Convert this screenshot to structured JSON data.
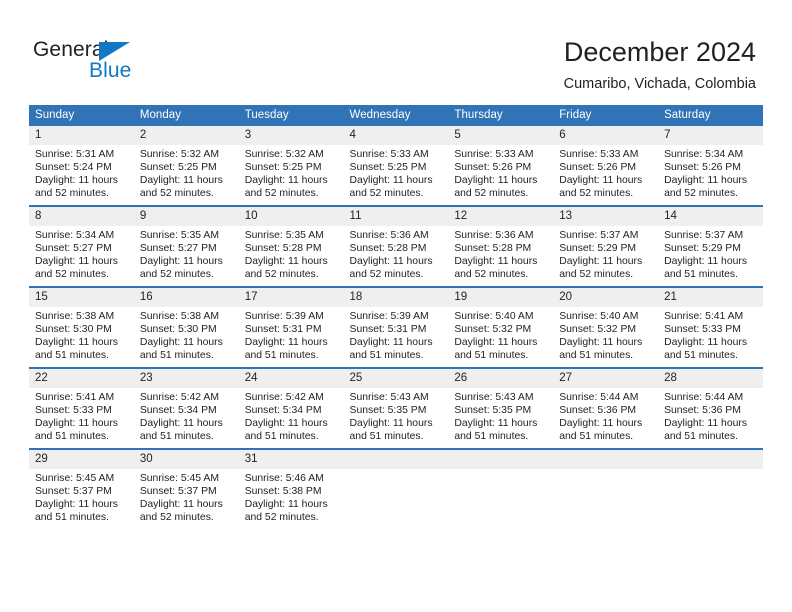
{
  "brand": {
    "name_part1": "General",
    "name_part2": "Blue"
  },
  "header": {
    "title": "December 2024",
    "subtitle": "Cumaribo, Vichada, Colombia"
  },
  "colors": {
    "header_blue": "#3073b7",
    "brand_blue": "#1277c4",
    "daynum_bg": "#efefef",
    "text": "#231f20"
  },
  "weekday_headers": [
    "Sunday",
    "Monday",
    "Tuesday",
    "Wednesday",
    "Thursday",
    "Friday",
    "Saturday"
  ],
  "weeks": [
    [
      {
        "day": "1",
        "sunrise": "Sunrise: 5:31 AM",
        "sunset": "Sunset: 5:24 PM",
        "daylight": "Daylight: 11 hours and 52 minutes."
      },
      {
        "day": "2",
        "sunrise": "Sunrise: 5:32 AM",
        "sunset": "Sunset: 5:25 PM",
        "daylight": "Daylight: 11 hours and 52 minutes."
      },
      {
        "day": "3",
        "sunrise": "Sunrise: 5:32 AM",
        "sunset": "Sunset: 5:25 PM",
        "daylight": "Daylight: 11 hours and 52 minutes."
      },
      {
        "day": "4",
        "sunrise": "Sunrise: 5:33 AM",
        "sunset": "Sunset: 5:25 PM",
        "daylight": "Daylight: 11 hours and 52 minutes."
      },
      {
        "day": "5",
        "sunrise": "Sunrise: 5:33 AM",
        "sunset": "Sunset: 5:26 PM",
        "daylight": "Daylight: 11 hours and 52 minutes."
      },
      {
        "day": "6",
        "sunrise": "Sunrise: 5:33 AM",
        "sunset": "Sunset: 5:26 PM",
        "daylight": "Daylight: 11 hours and 52 minutes."
      },
      {
        "day": "7",
        "sunrise": "Sunrise: 5:34 AM",
        "sunset": "Sunset: 5:26 PM",
        "daylight": "Daylight: 11 hours and 52 minutes."
      }
    ],
    [
      {
        "day": "8",
        "sunrise": "Sunrise: 5:34 AM",
        "sunset": "Sunset: 5:27 PM",
        "daylight": "Daylight: 11 hours and 52 minutes."
      },
      {
        "day": "9",
        "sunrise": "Sunrise: 5:35 AM",
        "sunset": "Sunset: 5:27 PM",
        "daylight": "Daylight: 11 hours and 52 minutes."
      },
      {
        "day": "10",
        "sunrise": "Sunrise: 5:35 AM",
        "sunset": "Sunset: 5:28 PM",
        "daylight": "Daylight: 11 hours and 52 minutes."
      },
      {
        "day": "11",
        "sunrise": "Sunrise: 5:36 AM",
        "sunset": "Sunset: 5:28 PM",
        "daylight": "Daylight: 11 hours and 52 minutes."
      },
      {
        "day": "12",
        "sunrise": "Sunrise: 5:36 AM",
        "sunset": "Sunset: 5:28 PM",
        "daylight": "Daylight: 11 hours and 52 minutes."
      },
      {
        "day": "13",
        "sunrise": "Sunrise: 5:37 AM",
        "sunset": "Sunset: 5:29 PM",
        "daylight": "Daylight: 11 hours and 52 minutes."
      },
      {
        "day": "14",
        "sunrise": "Sunrise: 5:37 AM",
        "sunset": "Sunset: 5:29 PM",
        "daylight": "Daylight: 11 hours and 51 minutes."
      }
    ],
    [
      {
        "day": "15",
        "sunrise": "Sunrise: 5:38 AM",
        "sunset": "Sunset: 5:30 PM",
        "daylight": "Daylight: 11 hours and 51 minutes."
      },
      {
        "day": "16",
        "sunrise": "Sunrise: 5:38 AM",
        "sunset": "Sunset: 5:30 PM",
        "daylight": "Daylight: 11 hours and 51 minutes."
      },
      {
        "day": "17",
        "sunrise": "Sunrise: 5:39 AM",
        "sunset": "Sunset: 5:31 PM",
        "daylight": "Daylight: 11 hours and 51 minutes."
      },
      {
        "day": "18",
        "sunrise": "Sunrise: 5:39 AM",
        "sunset": "Sunset: 5:31 PM",
        "daylight": "Daylight: 11 hours and 51 minutes."
      },
      {
        "day": "19",
        "sunrise": "Sunrise: 5:40 AM",
        "sunset": "Sunset: 5:32 PM",
        "daylight": "Daylight: 11 hours and 51 minutes."
      },
      {
        "day": "20",
        "sunrise": "Sunrise: 5:40 AM",
        "sunset": "Sunset: 5:32 PM",
        "daylight": "Daylight: 11 hours and 51 minutes."
      },
      {
        "day": "21",
        "sunrise": "Sunrise: 5:41 AM",
        "sunset": "Sunset: 5:33 PM",
        "daylight": "Daylight: 11 hours and 51 minutes."
      }
    ],
    [
      {
        "day": "22",
        "sunrise": "Sunrise: 5:41 AM",
        "sunset": "Sunset: 5:33 PM",
        "daylight": "Daylight: 11 hours and 51 minutes."
      },
      {
        "day": "23",
        "sunrise": "Sunrise: 5:42 AM",
        "sunset": "Sunset: 5:34 PM",
        "daylight": "Daylight: 11 hours and 51 minutes."
      },
      {
        "day": "24",
        "sunrise": "Sunrise: 5:42 AM",
        "sunset": "Sunset: 5:34 PM",
        "daylight": "Daylight: 11 hours and 51 minutes."
      },
      {
        "day": "25",
        "sunrise": "Sunrise: 5:43 AM",
        "sunset": "Sunset: 5:35 PM",
        "daylight": "Daylight: 11 hours and 51 minutes."
      },
      {
        "day": "26",
        "sunrise": "Sunrise: 5:43 AM",
        "sunset": "Sunset: 5:35 PM",
        "daylight": "Daylight: 11 hours and 51 minutes."
      },
      {
        "day": "27",
        "sunrise": "Sunrise: 5:44 AM",
        "sunset": "Sunset: 5:36 PM",
        "daylight": "Daylight: 11 hours and 51 minutes."
      },
      {
        "day": "28",
        "sunrise": "Sunrise: 5:44 AM",
        "sunset": "Sunset: 5:36 PM",
        "daylight": "Daylight: 11 hours and 51 minutes."
      }
    ],
    [
      {
        "day": "29",
        "sunrise": "Sunrise: 5:45 AM",
        "sunset": "Sunset: 5:37 PM",
        "daylight": "Daylight: 11 hours and 51 minutes."
      },
      {
        "day": "30",
        "sunrise": "Sunrise: 5:45 AM",
        "sunset": "Sunset: 5:37 PM",
        "daylight": "Daylight: 11 hours and 52 minutes."
      },
      {
        "day": "31",
        "sunrise": "Sunrise: 5:46 AM",
        "sunset": "Sunset: 5:38 PM",
        "daylight": "Daylight: 11 hours and 52 minutes."
      },
      {
        "day": "",
        "sunrise": "",
        "sunset": "",
        "daylight": ""
      },
      {
        "day": "",
        "sunrise": "",
        "sunset": "",
        "daylight": ""
      },
      {
        "day": "",
        "sunrise": "",
        "sunset": "",
        "daylight": ""
      },
      {
        "day": "",
        "sunrise": "",
        "sunset": "",
        "daylight": ""
      }
    ]
  ]
}
